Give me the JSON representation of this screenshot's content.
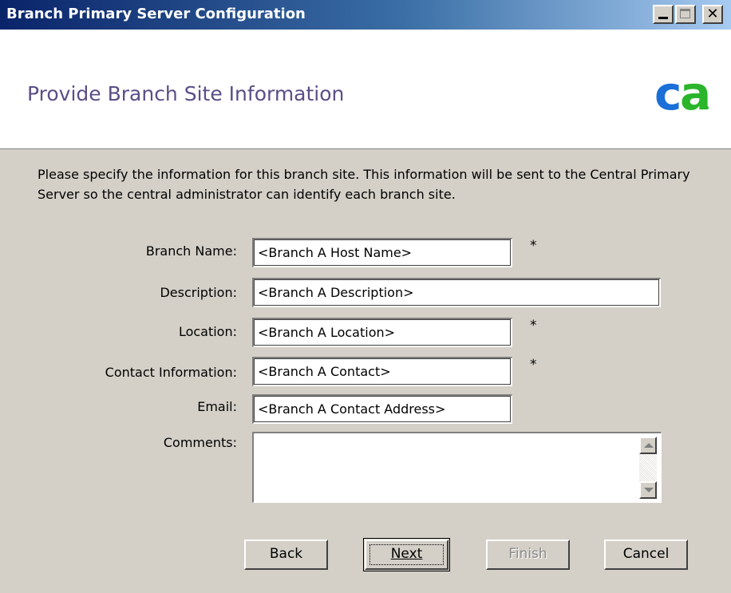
{
  "window": {
    "title": "Branch Primary Server Configuration"
  },
  "header": {
    "heading": "Provide Branch Site Information",
    "logo_text": "ca",
    "logo_colors": {
      "c": "#1a6fd8",
      "a": "#2ab52a",
      "dot": "#2ab52a"
    }
  },
  "intro": "Please specify the information for this branch site. This information will be sent to the Central Primary Server so the central administrator can identify each branch site.",
  "form": {
    "branch_name": {
      "label": "Branch Name:",
      "value": "<Branch A Host Name>",
      "required": "*"
    },
    "description": {
      "label": "Description:",
      "value": "<Branch A Description>"
    },
    "location": {
      "label": "Location:",
      "value": "<Branch A Location>",
      "required": "*"
    },
    "contact": {
      "label": "Contact Information:",
      "value": "<Branch A Contact>",
      "required": "*"
    },
    "email": {
      "label": "Email:",
      "value": "<Branch A Contact Address>"
    },
    "comments": {
      "label": "Comments:",
      "value": ""
    }
  },
  "buttons": {
    "back": "Back",
    "next": "Next",
    "finish": "Finish",
    "cancel": "Cancel"
  }
}
